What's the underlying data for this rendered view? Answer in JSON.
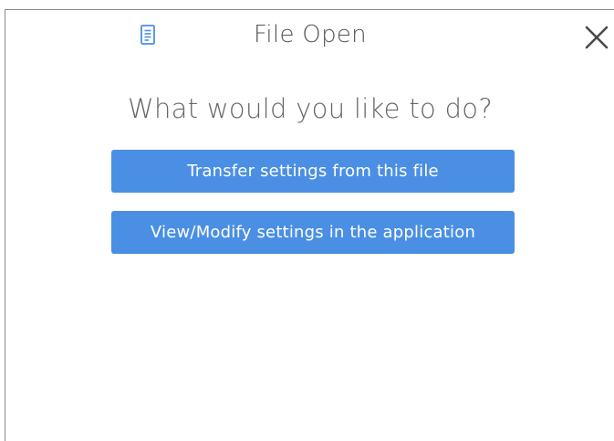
{
  "dialog": {
    "title": "File Open",
    "title_icon": "document-icon",
    "close_icon": "close-icon",
    "heading": "What would you like to do?",
    "buttons": {
      "transfer_label": "Transfer settings from this file",
      "view_label": "View/Modify settings in the application"
    }
  },
  "colors": {
    "accent": "#4a8fe4",
    "title_text": "#555555",
    "heading_text": "#666666",
    "icon": "#4a8fe4"
  }
}
